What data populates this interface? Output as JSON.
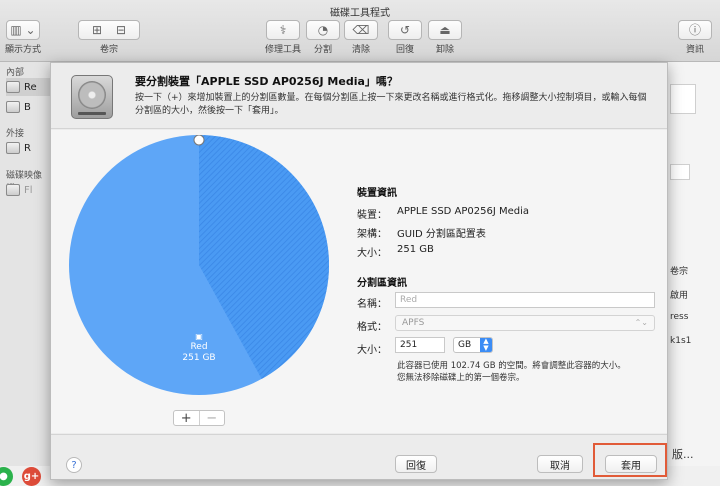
{
  "window": {
    "title": "磁碟工具程式"
  },
  "toolbar": {
    "view_label": "顯示方式",
    "volume_label": "卷宗",
    "first_aid_label": "修理工具",
    "partition_label": "分割",
    "erase_label": "清除",
    "restore_label": "回復",
    "unmount_label": "卸除",
    "info_label": "資訊"
  },
  "sidebar": {
    "internal_heading": "內部",
    "external_heading": "外接",
    "images_heading": "磁碟映像檔",
    "items": [
      {
        "label": "Re"
      },
      {
        "label": "B"
      },
      {
        "label": "R"
      },
      {
        "label": "Fl"
      }
    ]
  },
  "background": {
    "snippets": [
      "卷宗",
      "啟用",
      "ress",
      "k1s1",
      "版..."
    ]
  },
  "dialog": {
    "title": "要分割裝置「APPLE SSD AP0256J Media」嗎？",
    "description": "按一下（+）來增加裝置上的分割區數量。在每個分割區上按一下來更改名稱或進行格式化。拖移調整大小控制項目，或輸入每個分割區的大小，然後按一下「套用」。",
    "pie": {
      "partition_name": "Red",
      "partition_size": "251 GB",
      "used_fraction": 0.42,
      "free_color": "#5ea6f7",
      "used_color": "#3a8ef0"
    },
    "add_button": "+",
    "remove_button": "−",
    "device_info": {
      "heading": "裝置資訊",
      "device_label": "裝置：",
      "device_value": "APPLE SSD AP0256J Media",
      "scheme_label": "架構：",
      "scheme_value": "GUID 分割區配置表",
      "size_label": "大小：",
      "size_value": "251 GB"
    },
    "partition_info": {
      "heading": "分割區資訊",
      "name_label": "名稱：",
      "name_placeholder": "Red",
      "format_label": "格式：",
      "format_value": "APFS",
      "size_label": "大小：",
      "size_value": "251",
      "unit_value": "GB",
      "note_line1": "此容器已使用 102.74 GB 的空間。將會調整此容器的大小。",
      "note_line2": "您無法移除磁碟上的第一個卷宗。"
    },
    "footer": {
      "help": "?",
      "revert_label": "回復",
      "cancel_label": "取消",
      "apply_label": "套用"
    }
  },
  "social": {
    "google_plus": "g+"
  },
  "colors": {
    "accent": "#3b8cf5",
    "highlight": "#e15b38"
  }
}
